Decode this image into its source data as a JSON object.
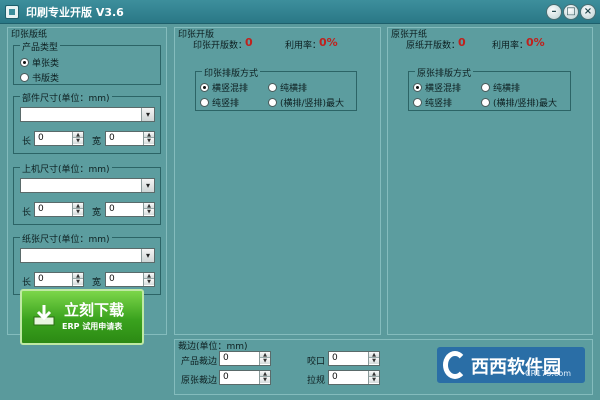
{
  "window": {
    "title": "印刷专业开版 V3.6"
  },
  "left": {
    "section_title": "印张版纸",
    "product_type": {
      "title": "产品类型",
      "options": [
        "单张类",
        "书版类"
      ],
      "selected": "单张类"
    },
    "part_size": {
      "title": "部件尺寸(单位：mm)",
      "length_label": "长",
      "width_label": "宽",
      "length_value": "0",
      "width_value": "0"
    },
    "machine_size": {
      "title": "上机尺寸(单位：mm)",
      "length_label": "长",
      "width_label": "宽",
      "length_value": "0",
      "width_value": "0"
    },
    "paper_size": {
      "title": "纸张尺寸(单位：mm)",
      "length_label": "长",
      "width_label": "宽",
      "length_value": "0",
      "width_value": "0"
    }
  },
  "download": {
    "main": "立刻下载",
    "sub": "ERP 试用申请表"
  },
  "print_sheet": {
    "title": "印张开版",
    "count_label": "印张开版数：",
    "count_value": "0",
    "util_label": "利用率：",
    "util_value": "0%",
    "layout": {
      "title": "印张排版方式",
      "options": [
        "横竖混排",
        "纯横排",
        "纯竖排",
        "(横排/竖排)最大"
      ],
      "selected": "横竖混排"
    }
  },
  "raw_sheet": {
    "title": "原张开纸",
    "count_label": "原纸开版数：",
    "count_value": "0",
    "util_label": "利用率：",
    "util_value": "0%",
    "layout": {
      "title": "原张排版方式",
      "options": [
        "横竖混排",
        "纯横排",
        "纯竖排",
        "(横排/竖排)最大"
      ],
      "selected": "横竖混排"
    }
  },
  "trim": {
    "title": "裁边(单位：mm)",
    "product_trim_label": "产品裁边",
    "product_trim_value": "0",
    "raw_trim_label": "原张裁边",
    "raw_trim_value": "0",
    "bite_label": "咬口",
    "bite_value": "0",
    "pull_label": "拉规",
    "pull_value": "0"
  },
  "watermark": {
    "text": "西西软件园",
    "sub": "CR173.com"
  },
  "colors": {
    "background": "#5a9a9c",
    "title_bar": "#2a7886",
    "accent_red": "#c0201c",
    "download_green": "#3aa21e"
  }
}
